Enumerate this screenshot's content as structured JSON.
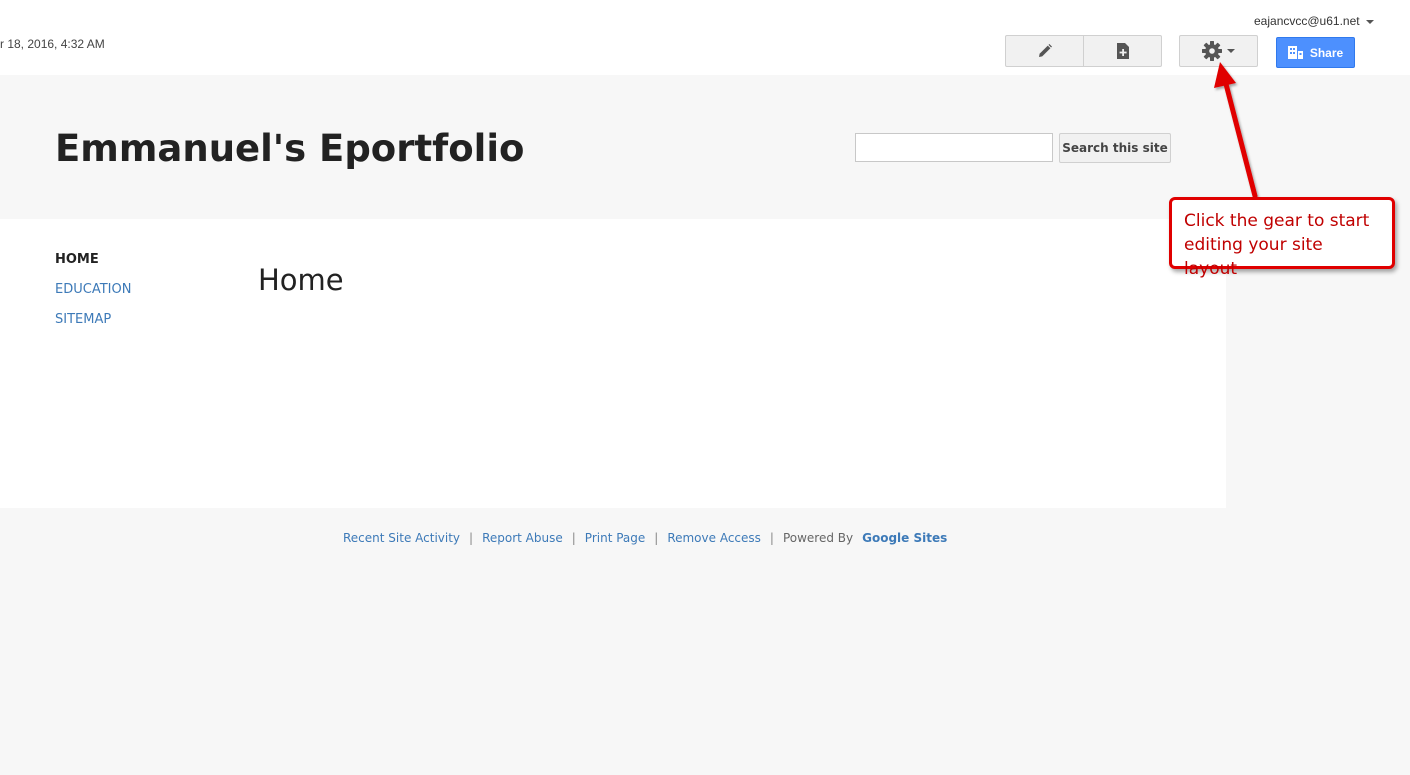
{
  "topbar": {
    "timestamp": "r 18, 2016, 4:32 AM",
    "account_email": "eajancvcc@u61.net",
    "share_label": "Share"
  },
  "icons": {
    "edit": "pencil-icon",
    "new_page": "new-page-icon",
    "settings": "gear-icon",
    "share": "share-people-icon"
  },
  "header": {
    "site_title": "Emmanuel's Eportfolio",
    "search_placeholder": "",
    "search_button": "Search this site"
  },
  "nav": {
    "items": [
      {
        "label": "HOME",
        "active": true
      },
      {
        "label": "EDUCATION",
        "active": false
      },
      {
        "label": "SITEMAP",
        "active": false
      }
    ]
  },
  "main": {
    "heading": "Home"
  },
  "footer": {
    "links": [
      "Recent Site Activity",
      "Report Abuse",
      "Print Page",
      "Remove Access"
    ],
    "powered_by": "Powered By",
    "google_sites": "Google Sites"
  },
  "callout": {
    "text": "Click the gear to start editing your site layout"
  },
  "colors": {
    "accent": "#4d90fe",
    "link": "#3d7ab8",
    "callout_red": "#e00000"
  }
}
